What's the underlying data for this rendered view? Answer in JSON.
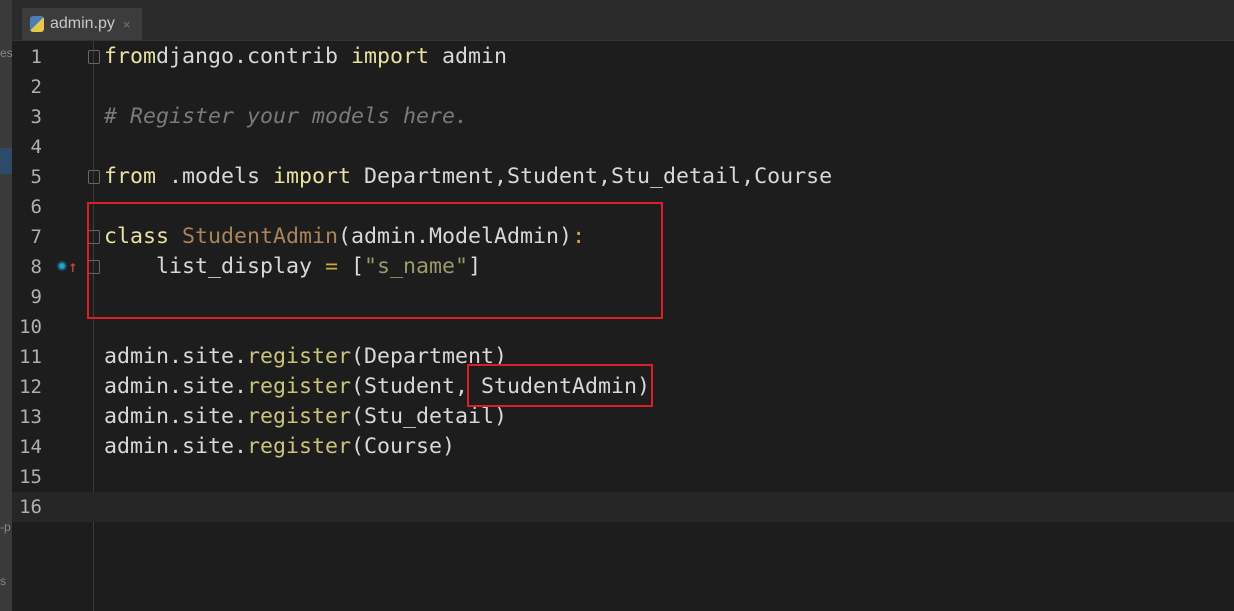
{
  "tab": {
    "filename": "admin.py",
    "close": "×"
  },
  "side_fragments": [
    "es",
    "-p",
    "s"
  ],
  "lines": [
    {
      "n": "1",
      "tokens": [
        [
          "kw",
          "from"
        ],
        [
          "",
          "django.contrib "
        ],
        [
          "kw",
          "import"
        ],
        [
          "",
          " admin"
        ]
      ]
    },
    {
      "n": "2",
      "tokens": []
    },
    {
      "n": "3",
      "tokens": [
        [
          "cm",
          "# Register your models here."
        ]
      ]
    },
    {
      "n": "4",
      "tokens": []
    },
    {
      "n": "5",
      "tokens": [
        [
          "kw",
          "from"
        ],
        [
          "",
          " .models "
        ],
        [
          "kw",
          "import"
        ],
        [
          "",
          " Department,Student,Stu_detail,Course"
        ]
      ]
    },
    {
      "n": "6",
      "tokens": []
    },
    {
      "n": "7",
      "tokens": [
        [
          "kw",
          "class"
        ],
        [
          "",
          " "
        ],
        [
          "cls",
          "StudentAdmin"
        ],
        [
          "",
          "(admin.ModelAdmin)"
        ],
        [
          "op",
          ":"
        ]
      ]
    },
    {
      "n": "8",
      "tokens": [
        [
          "",
          "    list_display "
        ],
        [
          "op",
          "="
        ],
        [
          "",
          " ["
        ],
        [
          "str",
          "\"s_name\""
        ],
        [
          "",
          "]"
        ]
      ]
    },
    {
      "n": "9",
      "tokens": []
    },
    {
      "n": "10",
      "tokens": []
    },
    {
      "n": "11",
      "tokens": [
        [
          "",
          "admin.site."
        ],
        [
          "fn",
          "register"
        ],
        [
          "",
          "(Department)"
        ]
      ]
    },
    {
      "n": "12",
      "tokens": [
        [
          "",
          "admin.site."
        ],
        [
          "fn",
          "register"
        ],
        [
          "",
          "(Student, StudentAdmin)"
        ]
      ]
    },
    {
      "n": "13",
      "tokens": [
        [
          "",
          "admin.site."
        ],
        [
          "fn",
          "register"
        ],
        [
          "",
          "(Stu_detail)"
        ]
      ]
    },
    {
      "n": "14",
      "tokens": [
        [
          "",
          "admin.site."
        ],
        [
          "fn",
          "register"
        ],
        [
          "",
          "(Course)"
        ]
      ]
    },
    {
      "n": "15",
      "tokens": []
    },
    {
      "n": "16",
      "tokens": []
    }
  ],
  "current_line": "16",
  "highlight_color": "#d8202a"
}
